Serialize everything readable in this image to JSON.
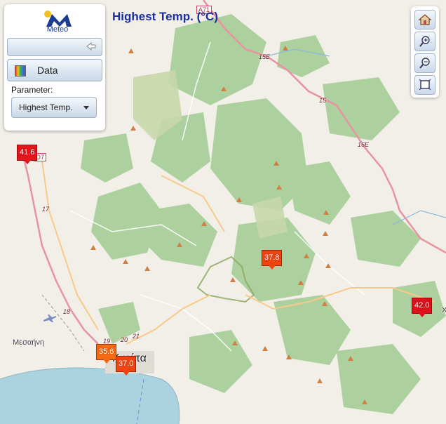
{
  "panel": {
    "logo_text": "Meteo",
    "data_label": "Data",
    "parameter_label": "Parameter:",
    "parameter_value": "Highest Temp."
  },
  "map": {
    "title": "Highest Temp. (°C)",
    "places": {
      "mesaini": "Μεσαήνη",
      "kalamata": "Κ        μάτα",
      "edge": "Χ"
    },
    "roads": [
      "A71",
      "15E",
      "15",
      "16E",
      "17",
      "18",
      "19",
      "20",
      "21",
      "O7"
    ],
    "markers": [
      {
        "value": "41.6",
        "color": "#e3161b"
      },
      {
        "value": "37.8",
        "color": "#ef4412"
      },
      {
        "value": "42.0",
        "color": "#dd101b"
      },
      {
        "value": "35.6",
        "color": "#f56a14"
      },
      {
        "value": "37.0",
        "color": "#ef4412"
      }
    ]
  },
  "colors": {
    "accent": "#1a2fa0",
    "forest": "#add19e",
    "sea": "#aad3df",
    "motorway": "#e892a2"
  }
}
